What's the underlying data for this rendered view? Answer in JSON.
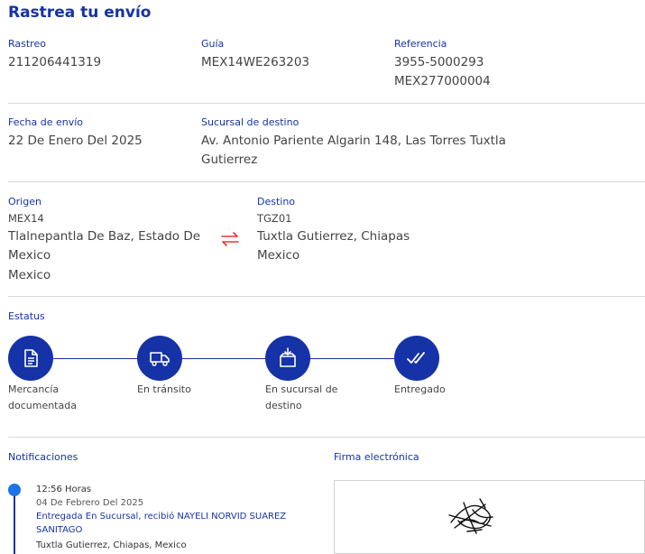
{
  "page_title": "Rastrea tu envío",
  "shipment": {
    "tracking_label": "Rastreo",
    "tracking_value": "211206441319",
    "guide_label": "Guía",
    "guide_value": "MEX14WE263203",
    "reference_label": "Referencia",
    "reference_line1": "3955-5000293",
    "reference_line2": "MEX277000004",
    "ship_date_label": "Fecha de envío",
    "ship_date_value": "22 De Enero Del 2025",
    "dest_branch_label": "Sucursal de destino",
    "dest_branch_line1": "Av. Antonio Pariente Algarin 148, Las Torres Tuxtla",
    "dest_branch_line2": "Gutierrez"
  },
  "origin": {
    "label": "Origen",
    "code": "MEX14",
    "city_line1": "Tlalnepantla De Baz, Estado De",
    "city_line2": "Mexico",
    "country": "Mexico"
  },
  "destination": {
    "label": "Destino",
    "code": "TGZ01",
    "city": "Tuxtla Gutierrez, Chiapas",
    "country": "Mexico"
  },
  "status": {
    "label": "Estatus",
    "steps": [
      {
        "line1": "Mercancía",
        "line2": "documentada",
        "icon": "document-icon"
      },
      {
        "line1": "En tránsito",
        "line2": "",
        "icon": "truck-icon"
      },
      {
        "line1": "En sucursal de",
        "line2": "destino",
        "icon": "box-icon"
      },
      {
        "line1": "Entregado",
        "line2": "",
        "icon": "double-check-icon"
      }
    ],
    "accent_color": "#1533a6"
  },
  "notifications": {
    "label": "Notificaciones",
    "items": [
      {
        "time": "12:56 Horas",
        "date": "04 De Febrero Del 2025",
        "event_line1": "Entregada En Sucursal, recibió NAYELI NORVID SUAREZ",
        "event_line2": "SANITAGO",
        "location": "Tuxtla Gutierrez, Chiapas, Mexico"
      }
    ]
  },
  "signature": {
    "label": "Firma electrónica"
  }
}
